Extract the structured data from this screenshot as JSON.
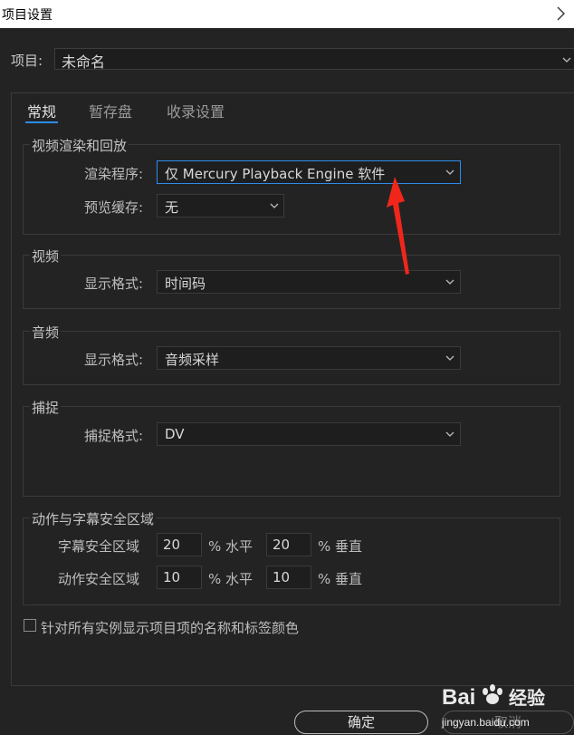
{
  "window": {
    "title": "项目设置"
  },
  "project": {
    "label": "项目:",
    "value": "未命名"
  },
  "tabs": [
    {
      "label": "常规",
      "active": true
    },
    {
      "label": "暂存盘",
      "active": false
    },
    {
      "label": "收录设置",
      "active": false
    }
  ],
  "video_render": {
    "title": "视频渲染和回放",
    "renderer_label": "渲染程序:",
    "renderer_value": "仅 Mercury Playback Engine 软件",
    "preview_cache_label": "预览缓存:",
    "preview_cache_value": "无"
  },
  "video": {
    "title": "视频",
    "format_label": "显示格式:",
    "format_value": "时间码"
  },
  "audio": {
    "title": "音频",
    "format_label": "显示格式:",
    "format_value": "音频采样"
  },
  "capture": {
    "title": "捕捉",
    "format_label": "捕捉格式:",
    "format_value": "DV"
  },
  "safe_areas": {
    "title": "动作与字幕安全区域",
    "title_safe_label": "字幕安全区域",
    "title_safe_h": "20",
    "title_safe_v": "20",
    "action_safe_label": "动作安全区域",
    "action_safe_h": "10",
    "action_safe_v": "10",
    "horizontal_unit": "% 水平",
    "vertical_unit": "% 垂直"
  },
  "checkbox": {
    "label": "针对所有实例显示项目项的名称和标签颜色",
    "checked": false
  },
  "buttons": {
    "ok": "确定",
    "cancel": "取消"
  },
  "watermark": {
    "text": "Bai 经验",
    "url": "jingyan.baidu.com"
  },
  "colors": {
    "accent": "#2d8ceb",
    "arrow": "#f0261b",
    "background": "#232323"
  }
}
